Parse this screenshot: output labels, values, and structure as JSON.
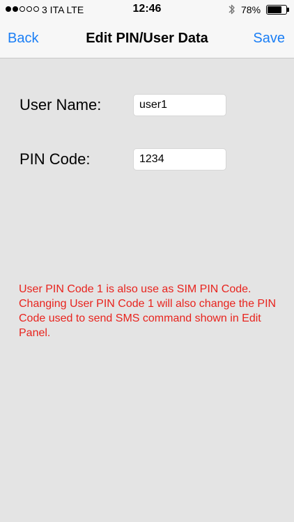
{
  "status_bar": {
    "signal_dots": [
      true,
      true,
      false,
      false,
      false
    ],
    "carrier": "3 ITA   LTE",
    "time": "12:46",
    "battery_percent": "78%",
    "battery_level": 0.78
  },
  "nav": {
    "back_label": "Back",
    "title": "Edit PIN/User Data",
    "save_label": "Save"
  },
  "form": {
    "username_label": "User Name:",
    "username_value": "user1",
    "pin_label": "PIN Code:",
    "pin_value": "1234"
  },
  "notice": {
    "text": "User PIN Code 1 is also use as SIM PIN Code. Changing User PIN Code 1 will also change the PIN Code used to send SMS command shown in Edit Panel.",
    "color": "#e8231d"
  },
  "colors": {
    "accent": "#1a7ef5",
    "background": "#e4e4e4",
    "bar": "#f7f7f7"
  }
}
